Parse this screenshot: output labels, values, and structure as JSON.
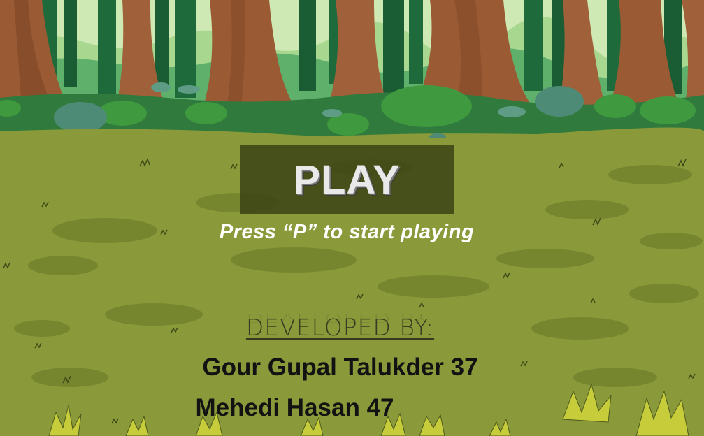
{
  "menu": {
    "play_label": "PLAY",
    "hint": "Press  “P” to start playing"
  },
  "credits": {
    "heading": "DEVELOPED BY:",
    "developers": [
      "Gour Gupal Talukder 37",
      "Mehedi Hasan 47"
    ]
  },
  "colors": {
    "sky": "#cfe9b4",
    "forest_dark": "#1f6a3a",
    "trunk": "#9a5a34",
    "grass": "#8a9a3a",
    "grass_patch": "#76862f",
    "play_panel": "#3e4616",
    "hint_text": "#ffffff"
  }
}
